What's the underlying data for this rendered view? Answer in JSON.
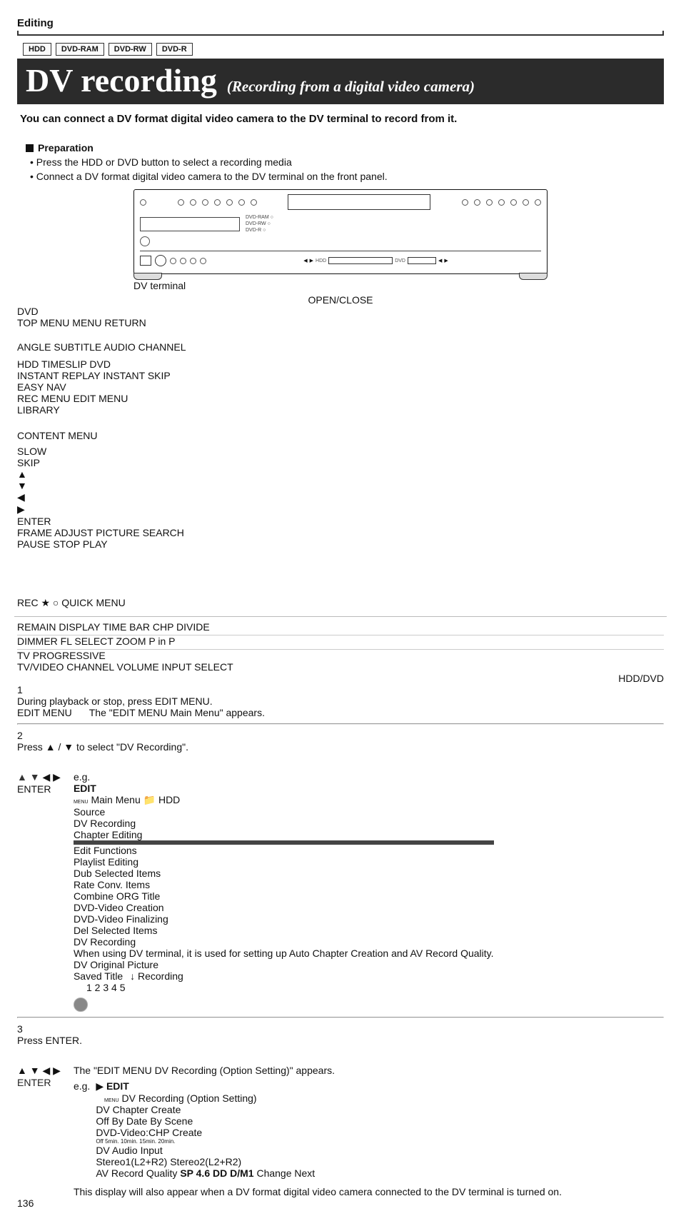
{
  "header": {
    "section_label": "Editing",
    "badges": [
      "HDD",
      "DVD-RAM",
      "DVD-RW",
      "DVD-R"
    ],
    "title_main": "DV recording",
    "title_sub": "(Recording from a digital video camera)"
  },
  "intro": "You can connect a DV format digital video camera to the DV terminal to record from it.",
  "preparation": {
    "heading": "Preparation",
    "bullets": [
      "Press the HDD or DVD button to select a recording media",
      "Connect a DV format digital video camera to the DV terminal on the front panel."
    ]
  },
  "device": {
    "front_labels": {
      "l1": "DVD-RAM",
      "l2": "DVD-RW",
      "l3": "DVD-R"
    },
    "lcd": {
      "hdd": "HDD",
      "dvd": "DVD"
    },
    "dv_terminal_label": "DV terminal"
  },
  "remote": {
    "labels": {
      "open_close": "OPEN/CLOSE",
      "dvd": "DVD",
      "top_menu": "TOP MENU",
      "menu": "MENU",
      "return": "RETURN",
      "angle": "ANGLE",
      "subtitle": "SUBTITLE",
      "audio": "AUDIO",
      "channel": "CHANNEL",
      "hdd": "HDD",
      "timeslip": "TIMESLIP",
      "dvd2": "DVD",
      "instant_replay": "INSTANT REPLAY",
      "instant_skip": "INSTANT SKIP",
      "easy_nav": "EASY NAV",
      "rec_menu": "REC MENU",
      "edit_menu": "EDIT MENU",
      "library": "LIBRARY",
      "content_menu": "CONTENT MENU",
      "slow": "SLOW",
      "skip": "SKIP",
      "frame": "FRAME",
      "adjust": "ADJUST",
      "picture": "PICTURE",
      "search": "SEARCH",
      "enter": "ENTER",
      "pause": "PAUSE",
      "stop": "STOP",
      "play": "PLAY",
      "rec": "REC",
      "star": "★",
      "quick_menu": "QUICK MENU",
      "remain": "REMAIN",
      "display": "DISPLAY",
      "time_bar": "TIME BAR",
      "chp_divide": "CHP DIVIDE",
      "dimmer": "DIMMER",
      "fl_select": "FL SELECT",
      "zoom": "ZOOM",
      "pinp": "P in P",
      "tv": "TV",
      "progressive": "PROGRESSIVE",
      "tv_video": "TV/VIDEO",
      "channel2": "CHANNEL",
      "volume": "VOLUME",
      "input_select": "INPUT SELECT"
    },
    "caption": "HDD/DVD"
  },
  "steps": {
    "s1": {
      "num": "1",
      "title": "During playback or stop, press EDIT MENU.",
      "body": "The \"EDIT MENU Main Menu\" appears.",
      "icon_label": "EDIT MENU"
    },
    "s2": {
      "num": "2",
      "title_pre": "Press ",
      "title_mid": " / ",
      "title_post": " to select \"DV Recording\".",
      "eg": "e.g.",
      "osd": {
        "title_prefix": "EDIT",
        "title_suffix": "MENU",
        "title_rest": "Main Menu",
        "media": "HDD",
        "main_big": "DV Recording",
        "main_small": "When using DV terminal, it is used for setting up Auto Chapter Creation and AV Record Quality.",
        "orig_pic": "DV Original Picture",
        "saved_title": "Saved Title",
        "recording": "Recording",
        "side_header_source": "Source",
        "side_sel": "DV Recording",
        "side_items": [
          "Chapter Editing",
          "Edit Functions",
          "Playlist Editing",
          "Dub Selected Items",
          "Rate Conv. Items",
          "Combine ORG Title",
          "DVD-Video Creation",
          "DVD-Video Finalizing",
          "Del Selected Items"
        ],
        "nums": [
          "1",
          "2",
          "3",
          "4",
          "5"
        ]
      }
    },
    "s3": {
      "num": "3",
      "title": "Press ENTER.",
      "body1": "The \"EDIT MENU DV Recording (Option Setting)\" appears.",
      "eg": "e.g.",
      "osd": {
        "title_prefix": "EDIT",
        "title_suffix": "MENU",
        "title_rest": "DV Recording (Option Setting)",
        "rows": [
          {
            "label": "DV Chapter Create",
            "opts": [
              "Off",
              "By Date",
              "By Scene"
            ],
            "sel": 0
          },
          {
            "label": "DVD-Video:CHP Create",
            "opts": [
              "Off",
              "5min.",
              "10min.",
              "15min.",
              "20min."
            ],
            "sel": 0
          },
          {
            "label": "DV Audio Input",
            "opts": [
              "Stereo1(L2+R2)",
              "Stereo2(L2+R2)"
            ],
            "sel": 0
          }
        ],
        "avq_label": "AV Record Quality",
        "avq_value": "SP 4.6 DD D/M1",
        "change": "Change",
        "next": "Next"
      },
      "body2": "This display will also appear when a DV format digital video camera connected to the DV terminal is turned on."
    }
  },
  "page_number": "136"
}
